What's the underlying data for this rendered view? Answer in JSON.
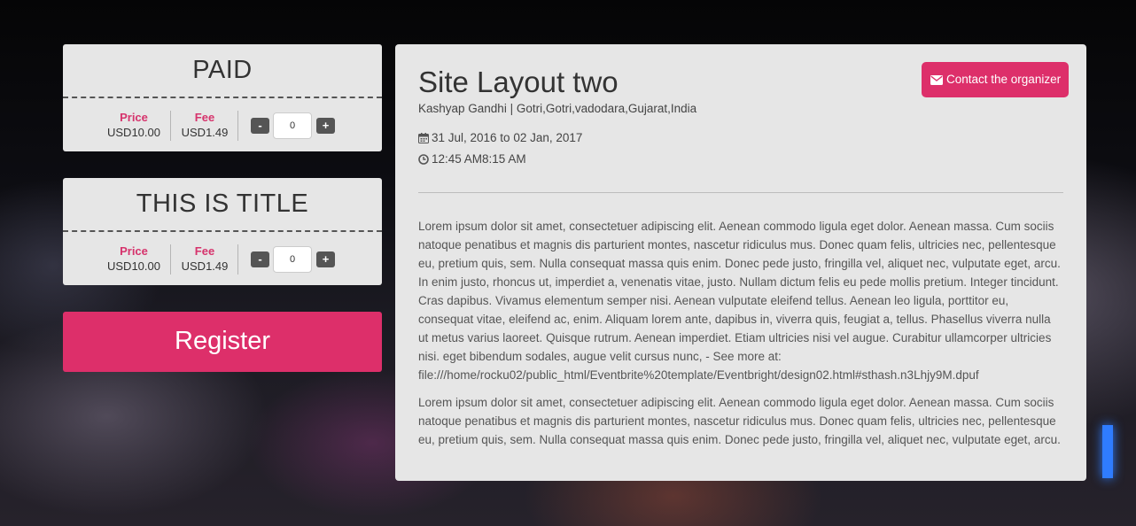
{
  "tickets": [
    {
      "title": "PAID",
      "price_label": "Price",
      "price": "USD10.00",
      "fee_label": "Fee",
      "fee": "USD1.49",
      "minus": "-",
      "qty": "0",
      "plus": "+"
    },
    {
      "title": "THIS IS TITLE",
      "price_label": "Price",
      "price": "USD10.00",
      "fee_label": "Fee",
      "fee": "USD1.49",
      "minus": "-",
      "qty": "0",
      "plus": "+"
    }
  ],
  "register_label": "Register",
  "event": {
    "title": "Site Layout two",
    "organizer_line": "Kashyap Gandhi | Gotri,Gotri,vadodara,Gujarat,India",
    "date": "31 Jul, 2016 to 02 Jan, 2017",
    "time": "12:45 AM8:15 AM",
    "contact_label": "Contact the organizer",
    "description_1": "Lorem ipsum dolor sit amet, consectetuer adipiscing elit. Aenean commodo ligula eget dolor. Aenean massa. Cum sociis natoque penatibus et magnis dis parturient montes, nascetur ridiculus mus. Donec quam felis, ultricies nec, pellentesque eu, pretium quis, sem. Nulla consequat massa quis enim. Donec pede justo, fringilla vel, aliquet nec, vulputate eget, arcu. In enim justo, rhoncus ut, imperdiet a, venenatis vitae, justo. Nullam dictum felis eu pede mollis pretium. Integer tincidunt. Cras dapibus. Vivamus elementum semper nisi. Aenean vulputate eleifend tellus. Aenean leo ligula, porttitor eu, consequat vitae, eleifend ac, enim. Aliquam lorem ante, dapibus in, viverra quis, feugiat a, tellus. Phasellus viverra nulla ut metus varius laoreet. Quisque rutrum. Aenean imperdiet. Etiam ultricies nisi vel augue. Curabitur ullamcorper ultricies nisi. eget bibendum sodales, augue velit cursus nunc, - See more at: file:///home/rocku02/public_html/Eventbrite%20template/Eventbright/design02.html#sthash.n3Lhjy9M.dpuf",
    "description_2": "Lorem ipsum dolor sit amet, consectetuer adipiscing elit. Aenean commodo ligula eget dolor. Aenean massa. Cum sociis natoque penatibus et magnis dis parturient montes, nascetur ridiculus mus. Donec quam felis, ultricies nec, pellentesque eu, pretium quis, sem. Nulla consequat massa quis enim. Donec pede justo, fringilla vel, aliquet nec, vulputate eget, arcu."
  },
  "icons": {
    "calendar": "calendar-icon",
    "clock": "clock-icon",
    "envelope": "envelope-icon"
  },
  "colors": {
    "accent": "#dd2f6a",
    "panel": "#e6e6e6",
    "label": "#d6336c"
  }
}
